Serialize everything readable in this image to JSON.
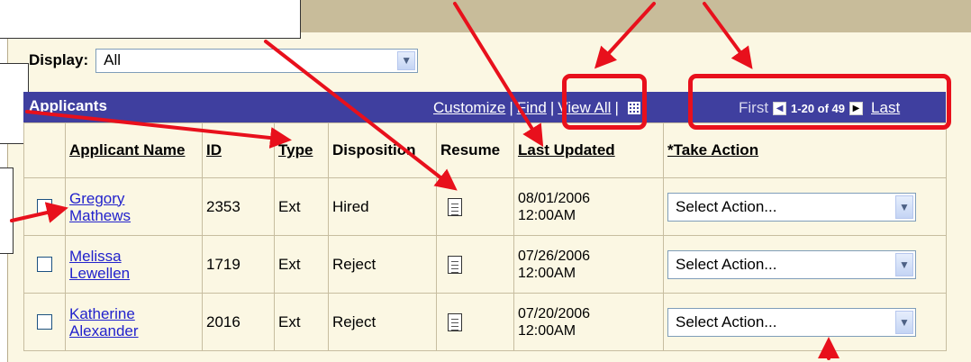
{
  "display": {
    "label": "Display:",
    "value": "All"
  },
  "grid": {
    "title": "Applicants",
    "links": {
      "customize": "Customize",
      "find": "Find",
      "view_all": "View All"
    },
    "pager": {
      "first": "First",
      "range": "1-20 of 49",
      "last": "Last"
    }
  },
  "columns": {
    "name": "Applicant Name",
    "id": "ID",
    "type": "Type",
    "disposition": "Disposition",
    "resume": "Resume",
    "last_updated": "Last Updated",
    "take_action": "*Take Action"
  },
  "rows": [
    {
      "first": "Gregory",
      "last": "Mathews",
      "id": "2353",
      "type": "Ext",
      "disposition": "Hired",
      "date": "08/01/2006",
      "time": "12:00AM",
      "action": "Select Action..."
    },
    {
      "first": "Melissa",
      "last": "Lewellen",
      "id": "1719",
      "type": "Ext",
      "disposition": "Reject",
      "date": "07/26/2006",
      "time": "12:00AM",
      "action": "Select Action..."
    },
    {
      "first": "Katherine",
      "last": "Alexander",
      "id": "2016",
      "type": "Ext",
      "disposition": "Reject",
      "date": "07/20/2006",
      "time": "12:00AM",
      "action": "Select Action..."
    }
  ],
  "colors": {
    "header": "#3f3f9f",
    "panel": "#fbf7e3",
    "tan": "#c8bc9a",
    "annotation": "#e8101c",
    "link": "#2222cc"
  },
  "icons": [
    "chevron-down-icon",
    "download-grid-icon",
    "first-arrow-icon",
    "next-arrow-icon",
    "resume-document-icon"
  ]
}
